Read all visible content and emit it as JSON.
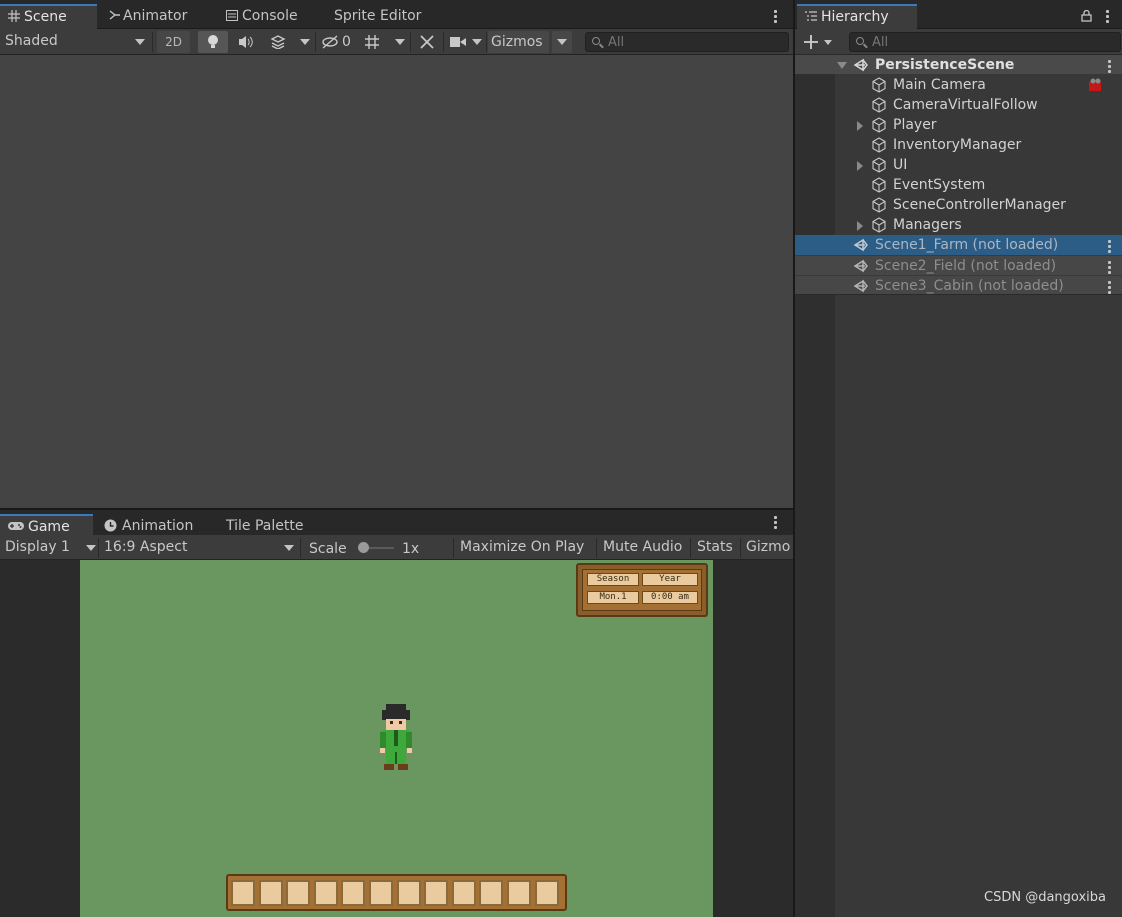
{
  "scene_panel": {
    "tabs": [
      {
        "label": "Scene",
        "icon": "grid-icon"
      },
      {
        "label": "Animator",
        "icon": "animator-icon"
      },
      {
        "label": "Console",
        "icon": "console-icon"
      },
      {
        "label": "Sprite Editor"
      }
    ],
    "toolbar": {
      "shading_mode": "Shaded",
      "mode_2d": "2D",
      "hidden_count": "0",
      "gizmos_label": "Gizmos",
      "search_placeholder": "All"
    }
  },
  "hierarchy": {
    "tab_label": "Hierarchy",
    "search_placeholder": "All",
    "root_scene": "PersistenceScene",
    "objects": [
      {
        "name": "Main Camera",
        "expandable": false
      },
      {
        "name": "CameraVirtualFollow",
        "expandable": false
      },
      {
        "name": "Player",
        "expandable": true
      },
      {
        "name": "InventoryManager",
        "expandable": false
      },
      {
        "name": "UI",
        "expandable": true
      },
      {
        "name": "EventSystem",
        "expandable": false
      },
      {
        "name": "SceneControllerManager",
        "expandable": false
      },
      {
        "name": "Managers",
        "expandable": true
      }
    ],
    "unloaded_scenes": [
      "Scene1_Farm (not loaded)",
      "Scene2_Field (not loaded)",
      "Scene3_Cabin (not loaded)"
    ]
  },
  "game_panel": {
    "tabs": [
      {
        "label": "Game",
        "icon": "gamepad-icon"
      },
      {
        "label": "Animation",
        "icon": "clock-icon"
      },
      {
        "label": "Tile Palette"
      }
    ],
    "toolbar": {
      "display": "Display 1",
      "aspect": "16:9 Aspect",
      "scale_label": "Scale",
      "scale_value": "1x",
      "maximize": "Maximize On Play",
      "mute": "Mute Audio",
      "stats": "Stats",
      "gizmos": "Gizmo"
    },
    "hud": {
      "season": "Season",
      "year": "Year",
      "day": "Mon.1",
      "time": "0:00 am"
    },
    "inventory_slots": 12
  },
  "watermark": "CSDN @dangoxiba",
  "colors": {
    "accent": "#3a79bb",
    "selection": "#2c5d87",
    "grass": "#6a9660"
  }
}
